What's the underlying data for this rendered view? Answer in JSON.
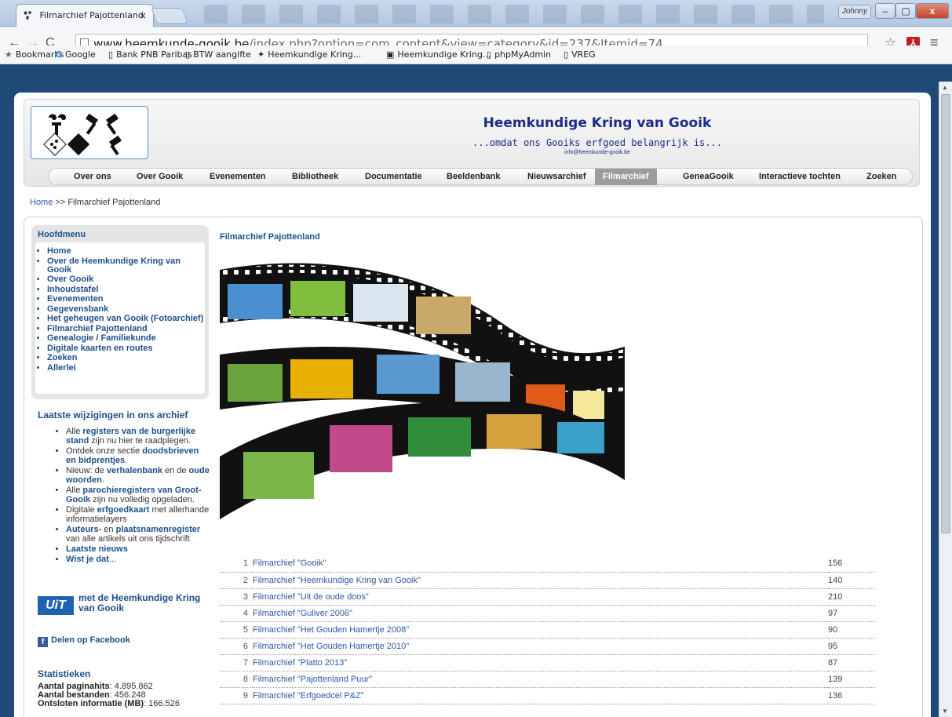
{
  "browser": {
    "tab_title": "Filmarchief Pajottenland",
    "tab_close": "×",
    "url_host": "www.heemkunde-gooik.be",
    "url_path": "/index.php?option=com_content&view=category&id=237&Itemid=74",
    "user_label": "Johnny",
    "bookmarks": [
      {
        "icon": "★",
        "label": "Bookmarks"
      },
      {
        "icon": "G",
        "label": "Google"
      },
      {
        "icon": "▯",
        "label": "Bank PNB Paribas"
      },
      {
        "icon": "▯",
        "label": "BTW aangifte"
      },
      {
        "icon": "✦",
        "label": "Heemkundige Kring..."
      },
      {
        "icon": "▣",
        "label": "Heemkundige Kring..."
      },
      {
        "icon": "▯",
        "label": "phpMyAdmin"
      },
      {
        "icon": "▯",
        "label": "VREG"
      }
    ]
  },
  "site": {
    "title": "Heemkundige Kring van Gooik",
    "subtitle": "...omdat ons Gooiks erfgoed belangrijk is...",
    "email": "info@heemkunde-gooik.be"
  },
  "nav": [
    "Over ons",
    "Over Gooik",
    "Evenementen",
    "Bibliotheek",
    "Documentatie",
    "Beeldenbank",
    "Nieuwsarchief",
    "Filmarchief",
    "GeneaGooik",
    "Interactieve tochten",
    "Zoeken"
  ],
  "nav_active": "Filmarchief",
  "breadcrumb": {
    "home": "Home",
    "sep": " >> ",
    "current": "Filmarchief Pajottenland"
  },
  "sidemenu": {
    "title": "Hoofdmenu",
    "items": [
      "Home",
      "Over de Heemkundige Kring van Gooik",
      "Over Gooik",
      "Inhoudstafel",
      "Evenementen",
      "Gegevensbank",
      "Het geheugen van Gooik (Fotoarchief)",
      "Filmarchief Pajottenland",
      "Genealogie / Familiekunde",
      "Digitale kaarten en routes",
      "Zoeken",
      "Allerlei"
    ]
  },
  "changes": {
    "title": "Laatste wijzigingen in ons archief",
    "items": [
      {
        "pre": "Alle ",
        "link": "registers van de burgerlijke stand",
        "post": " zijn nu hier te raadplegen."
      },
      {
        "pre": "Ontdek onze sectie ",
        "link": "doodsbrieven en bidprentjes",
        "post": "."
      },
      {
        "pre": "Nieuw: de ",
        "link": "verhalenbank",
        "post": " en de ",
        "link2": "oude woorden",
        "post2": "."
      },
      {
        "pre": "Alle ",
        "link": "parochieregisters van Groot-Gooik",
        "post": " zijn nu volledig opgeladen."
      },
      {
        "pre": "Digitale ",
        "link": "erfgoedkaart",
        "post": " met allerhande informatielayers"
      },
      {
        "pre": "",
        "link": "Auteurs-",
        "post": " en ",
        "link2": "plaatsnamenregister",
        "post2": " van alle artikels uit ons tijdschrift"
      },
      {
        "pre": "",
        "link": "Laatste nieuws",
        "post": ""
      },
      {
        "pre": "",
        "link": "Wist je dat",
        "post": "..."
      }
    ]
  },
  "uit": {
    "logo": "UiT",
    "text": "met de Heemkundige Kring van Gooik"
  },
  "facebook": "Delen op Facebook",
  "stats": {
    "title": "Statistieken",
    "rows": [
      {
        "label": "Aantal paginahits",
        "value": ": 4.895.862"
      },
      {
        "label": "Aantal bestanden",
        "value": ": 456.248"
      },
      {
        "label": "Ontsloten informatie (MB)",
        "value": ": 166.526"
      }
    ]
  },
  "main": {
    "title": "Filmarchief Pajottenland",
    "films": [
      {
        "n": "1",
        "title": "Filmarchief \"Gooik\"",
        "hits": "156"
      },
      {
        "n": "2",
        "title": "Filmarchief \"Heemkundige Kring van Gooik\"",
        "hits": "140"
      },
      {
        "n": "3",
        "title": "Filmarchief \"Uit de oude doos\"",
        "hits": "210"
      },
      {
        "n": "4",
        "title": "Filmarchief \"Guliver 2006\"",
        "hits": "97"
      },
      {
        "n": "5",
        "title": "Filmarchief \"Het Gouden Hamertje 2008\"",
        "hits": "90"
      },
      {
        "n": "6",
        "title": "Filmarchief \"Het Gouden Hamertje 2010\"",
        "hits": "95"
      },
      {
        "n": "7",
        "title": "Filmarchief \"Platto 2013\"",
        "hits": "87"
      },
      {
        "n": "8",
        "title": "Filmarchief \"Pajottenland Puur\"",
        "hits": "139"
      },
      {
        "n": "9",
        "title": "Filmarchief \"Erfgoedcel P&Z\"",
        "hits": "136"
      }
    ]
  }
}
